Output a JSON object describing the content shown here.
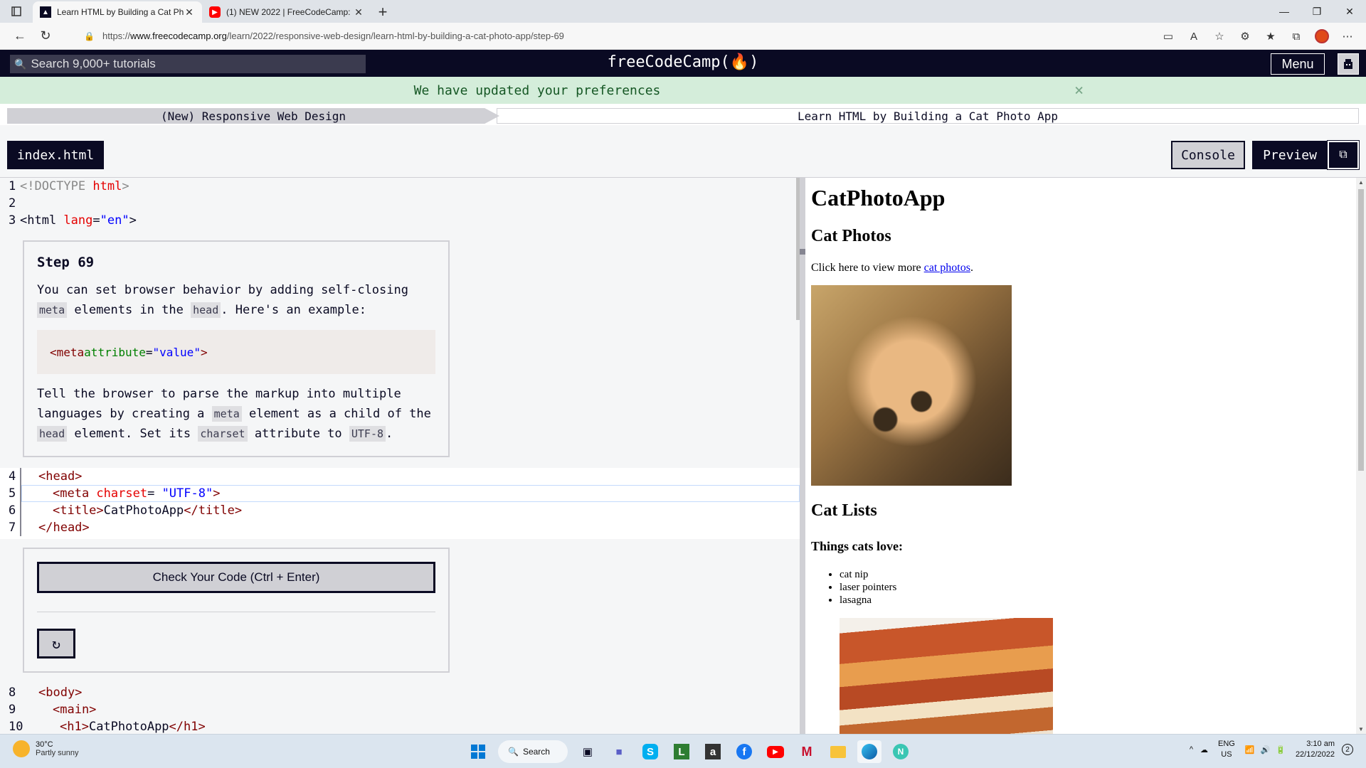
{
  "browser": {
    "tabs": [
      {
        "title": "Learn HTML by Building a Cat Ph",
        "favicon": "freecodecamp-icon",
        "active": true
      },
      {
        "title": "(1) NEW 2022 | FreeCodeCamp: l",
        "favicon": "youtube-icon",
        "active": false
      }
    ],
    "url_prefix": "https://",
    "url_host": "www.freecodecamp.org",
    "url_path": "/learn/2022/responsive-web-design/learn-html-by-building-a-cat-photo-app/step-69"
  },
  "header": {
    "search_placeholder": "Search 9,000+ tutorials",
    "brand": "freeCodeCamp(🔥)",
    "menu_label": "Menu"
  },
  "flash": {
    "message": "We have updated your preferences",
    "close": "×"
  },
  "breadcrumb": {
    "superblock": "(New) Responsive Web Design",
    "block": "Learn HTML by Building a Cat Photo App"
  },
  "toolbar": {
    "file_tab": "index.html",
    "console_label": "Console",
    "preview_label": "Preview"
  },
  "step": {
    "title": "Step 69",
    "p1_a": "You can set browser behavior by adding self-closing ",
    "p1_code1": "meta",
    "p1_b": " elements in the ",
    "p1_code2": "head",
    "p1_c": ". Here's an example:",
    "example_tag_open": "<meta",
    "example_attr": " attribute",
    "example_eq": "=",
    "example_val": "\"value\"",
    "example_tag_close": ">",
    "p2_a": "Tell the browser to parse the markup into multiple languages by creating a ",
    "p2_code1": "meta",
    "p2_b": " element as a child of the ",
    "p2_code2": "head",
    "p2_c": " element. Set its ",
    "p2_code3": "charset",
    "p2_d": " attribute to ",
    "p2_code4": "UTF-8",
    "p2_e": "."
  },
  "check": {
    "label": "Check Your Code (Ctrl + Enter)",
    "reset_icon": "reset-icon"
  },
  "code_lines": {
    "l1": {
      "num": "1",
      "a": "<!DOCTYPE ",
      "b": "html",
      "c": ">"
    },
    "l2": {
      "num": "2"
    },
    "l3": {
      "num": "3",
      "tag": "<html",
      "attr": " lang",
      "eq": "=",
      "val": "\"en\"",
      "close": ">"
    },
    "l4": {
      "num": "4",
      "text": "<head>"
    },
    "l5": {
      "num": "5",
      "tag": "<meta",
      "attr": " charset",
      "eq": "= ",
      "val": "\"UTF-8\"",
      "close": ">"
    },
    "l6": {
      "num": "6",
      "open": "<title>",
      "text": "CatPhotoApp",
      "close": "</title>"
    },
    "l7": {
      "num": "7",
      "text": "</head>"
    },
    "l8": {
      "num": "8",
      "text": "<body>"
    },
    "l9": {
      "num": "9",
      "text": "<main>"
    },
    "l10": {
      "num": "10",
      "open": "<h1>",
      "text": "CatPhotoApp",
      "close": "</h1>"
    }
  },
  "preview": {
    "h1": "CatPhotoApp",
    "h2_photos": "Cat Photos",
    "p_text": "Click here to view more ",
    "p_link": "cat photos",
    "p_end": ".",
    "h2_lists": "Cat Lists",
    "h3_love": "Things cats love:",
    "list": [
      "cat nip",
      "laser pointers",
      "lasagna"
    ]
  },
  "taskbar": {
    "temp": "30°C",
    "weather": "Partly sunny",
    "search_label": "Search",
    "lang1": "ENG",
    "lang2": "US",
    "time": "3:10 am",
    "date": "22/12/2022",
    "notif_count": "2"
  }
}
